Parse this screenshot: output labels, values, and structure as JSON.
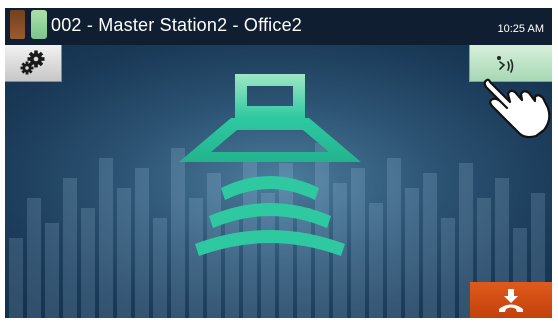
{
  "header": {
    "station_title": "002 - Master Station2 - Office2",
    "time": "10:25 AM"
  },
  "buttons": {
    "settings_icon": "gear-icon",
    "volume_icon": "volume-adjust-icon",
    "hangup_icon": "hang-up-icon"
  },
  "indicators": {
    "status_left": "red",
    "status_right": "green"
  },
  "main": {
    "icon": "speaker-icon"
  },
  "colors": {
    "accent_teal": "#2ec9a1",
    "hangup_orange": "#d14a12",
    "volume_green": "#b8e2c2"
  }
}
